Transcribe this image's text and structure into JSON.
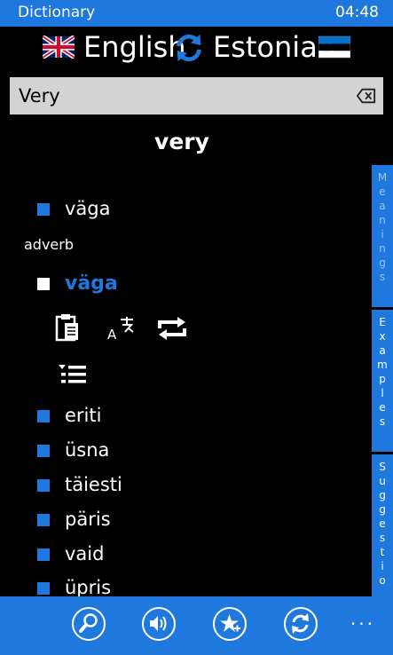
{
  "status_bar": {
    "app_title": "Dictionary",
    "clock": "04:48"
  },
  "languages": {
    "from": "English",
    "to": "Estonian"
  },
  "search": {
    "value": "Very"
  },
  "headword": "very",
  "side_tabs": {
    "meanings": "Meanings",
    "examples": "Examples",
    "suggestions": "Suggestio"
  },
  "translations": {
    "primary": "väga",
    "part_of_speech": "adverb",
    "selected": "väga",
    "alternatives": [
      "eriti",
      "üsna",
      "täiesti",
      "päris",
      "vaid",
      "üpris"
    ]
  },
  "icons": {
    "swap": "swap-refresh-icon",
    "clear": "backspace-clear-icon",
    "copy": "clipboard-copy-icon",
    "translate": "translate-icon",
    "repeat": "repeat-icon",
    "list": "list-menu-icon",
    "app_bar": [
      "search-icon",
      "speaker-icon",
      "favorite-star-icon",
      "sync-icon"
    ]
  },
  "colors": {
    "accent": "#1e78dd",
    "background": "#000000",
    "search_bg": "#d3d3d3"
  },
  "app_bar": {
    "more": "..."
  }
}
